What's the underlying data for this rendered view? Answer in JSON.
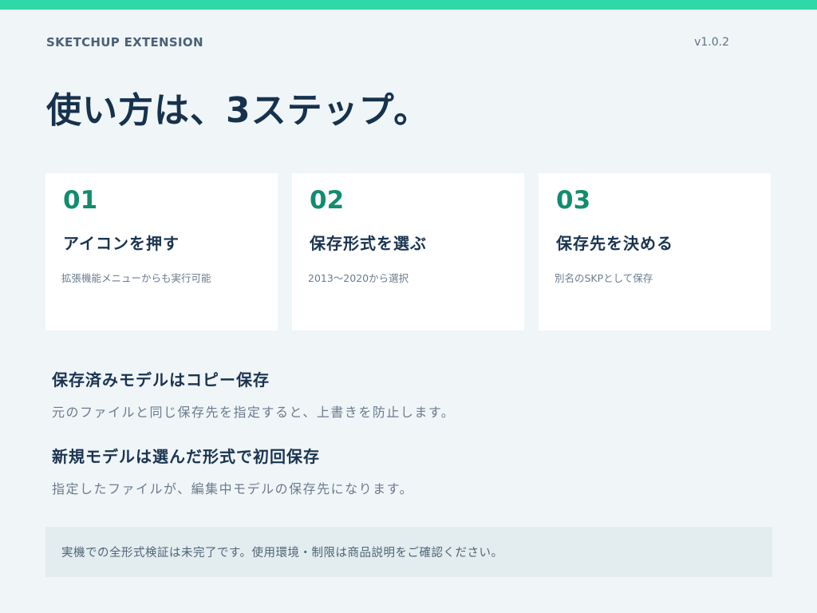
{
  "header": {
    "brand": "SKETCHUP EXTENSION",
    "version": "v1.0.2"
  },
  "headline": "使い方は、3ステップ。",
  "steps": [
    {
      "number": "01",
      "title": "アイコンを押す",
      "description": "拡張機能メニューからも実行可能"
    },
    {
      "number": "02",
      "title": "保存形式を選ぶ",
      "description": "2013〜2020から選択"
    },
    {
      "number": "03",
      "title": "保存先を決める",
      "description": "別名のSKPとして保存"
    }
  ],
  "sections": [
    {
      "title": "保存済みモデルはコピー保存",
      "description": "元のファイルと同じ保存先を指定すると、上書きを防止します。"
    },
    {
      "title": "新規モデルは選んだ形式で初回保存",
      "description": "指定したファイルが、編集中モデルの保存先になります。"
    }
  ],
  "note": "実機での全形式検証は未完了です。使用環境・制限は商品説明をご確認ください。",
  "colors": {
    "accent_bar": "#2ed8a8",
    "step_number": "#128c6e",
    "background": "#f0f5f8",
    "note_background": "#e3ecee"
  }
}
